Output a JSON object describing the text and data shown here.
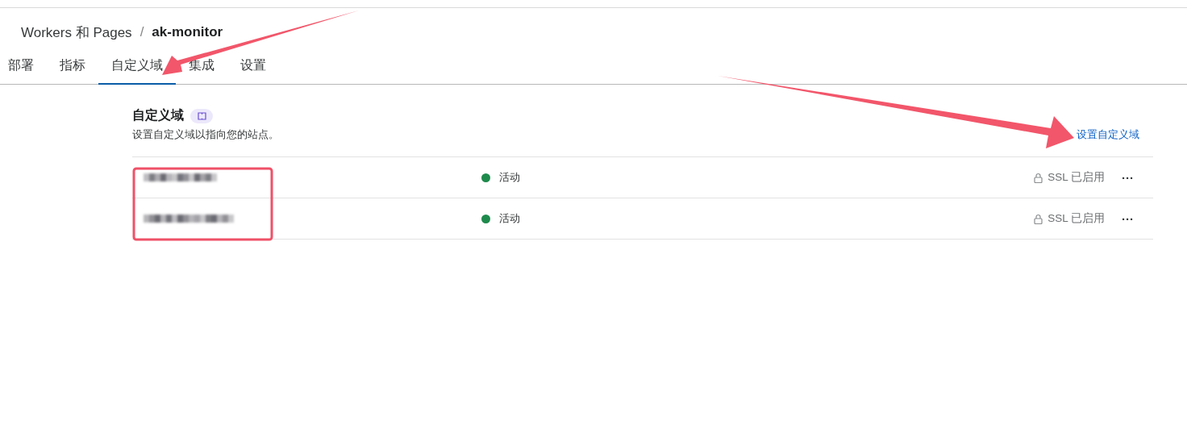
{
  "breadcrumb": {
    "parent": "Workers 和 Pages",
    "separator": "/",
    "current": "ak-monitor"
  },
  "tabs": [
    {
      "label": "部署",
      "selected": false
    },
    {
      "label": "指标",
      "selected": false
    },
    {
      "label": "自定义域",
      "selected": true
    },
    {
      "label": "集成",
      "selected": false
    },
    {
      "label": "设置",
      "selected": false
    }
  ],
  "section": {
    "title": "自定义域",
    "description": "设置自定义域以指向您的站点。",
    "action": "设置自定义域"
  },
  "domains": [
    {
      "domain": {
        "kind": "blurred"
      },
      "status": "活动",
      "color": "#1e8a4c",
      "ssl": "SSL 已启用",
      "menu": "···"
    },
    {
      "domain": {
        "kind": "blurred"
      },
      "status": "活动",
      "color": "#1e8a4c",
      "ssl": "SSL 已启用",
      "menu": "···"
    }
  ],
  "annotations": [
    {
      "kind": "arrow"
    },
    {
      "kind": "arrow"
    },
    {
      "kind": "frame"
    }
  ]
}
